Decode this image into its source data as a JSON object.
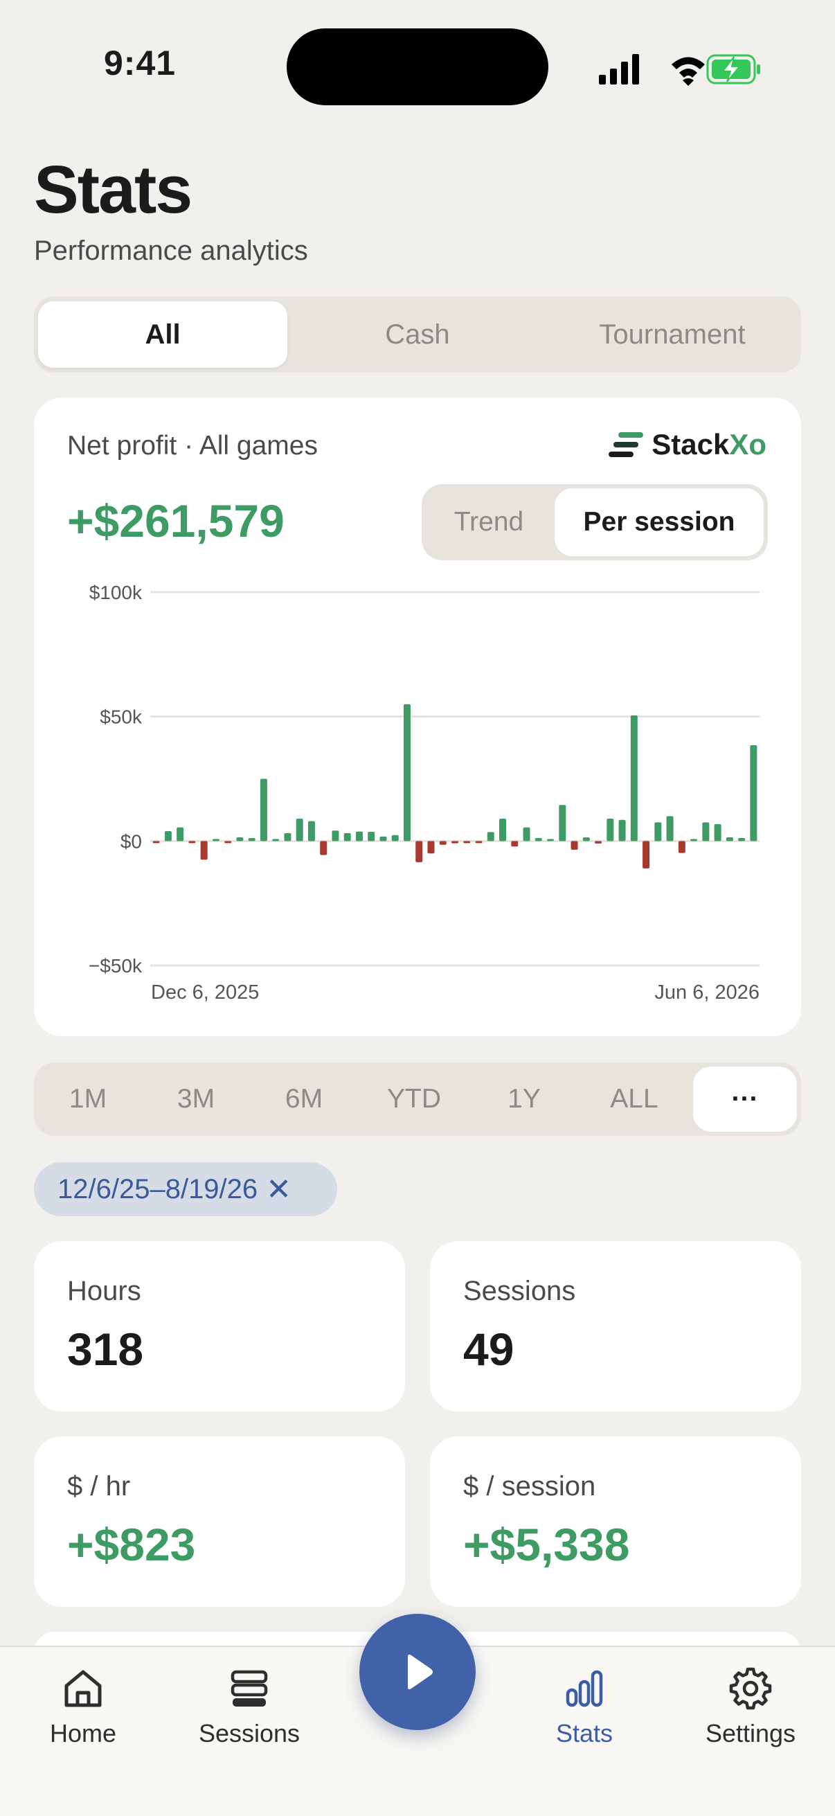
{
  "status_bar": {
    "time": "9:41",
    "icons": [
      "signal-icon",
      "wifi-icon",
      "battery-charging-icon"
    ],
    "battery_color": "#34C759"
  },
  "header": {
    "title": "Stats",
    "subtitle": "Performance analytics"
  },
  "game_filter": {
    "options": [
      "All",
      "Cash",
      "Tournament"
    ],
    "selected": "All"
  },
  "chart_card": {
    "label": "Net profit · All games",
    "brand_part1": "Stack",
    "brand_part2": "Xo",
    "net_value": "+$261,579",
    "view_toggle": {
      "options": [
        "Trend",
        "Per session"
      ],
      "selected": "Per session"
    }
  },
  "chart_data": {
    "type": "bar",
    "title": "",
    "xlabel": "",
    "ylabel": "",
    "ylim": [
      -50000,
      100000
    ],
    "y_ticks": [
      "$100k",
      "$50k",
      "$0",
      "−$50k"
    ],
    "x_tick_labels": [
      "Dec 6, 2025",
      "Jun 6, 2026"
    ],
    "grid": true,
    "colors": {
      "positive": "#3E9B63",
      "negative": "#A8392E"
    },
    "values": [
      -700,
      4000,
      5500,
      -800,
      -7500,
      500,
      -400,
      1500,
      1200,
      25000,
      800,
      3200,
      9000,
      8000,
      -5600,
      4200,
      3200,
      3800,
      3700,
      1800,
      2400,
      55000,
      -8500,
      -5000,
      -1500,
      -900,
      -700,
      -600,
      3600,
      9000,
      -2200,
      5500,
      1200,
      700,
      14500,
      -3500,
      1500,
      -1000,
      9000,
      8500,
      50500,
      -11000,
      7500,
      10000,
      -4800,
      600,
      7500,
      6800,
      1500,
      1200,
      38500
    ]
  },
  "range_selector": {
    "options": [
      "1M",
      "3M",
      "6M",
      "YTD",
      "1Y",
      "ALL",
      "···"
    ],
    "selected": "···"
  },
  "date_chip": {
    "label": "12/6/25–8/19/26",
    "close": "✕"
  },
  "stats": {
    "hours": {
      "label": "Hours",
      "value": "318"
    },
    "sessions": {
      "label": "Sessions",
      "value": "49"
    },
    "per_hour": {
      "label": "$ / hr",
      "value": "+$823"
    },
    "per_session": {
      "label": "$ / session",
      "value": "+$5,338"
    }
  },
  "tabbar": {
    "items": [
      {
        "label": "Home",
        "icon": "home-icon"
      },
      {
        "label": "Sessions",
        "icon": "stack-icon"
      },
      {
        "label": "Stats",
        "icon": "bar-chart-icon"
      },
      {
        "label": "Settings",
        "icon": "gear-icon"
      }
    ],
    "selected": "Stats",
    "fab_icon": "play-icon"
  }
}
